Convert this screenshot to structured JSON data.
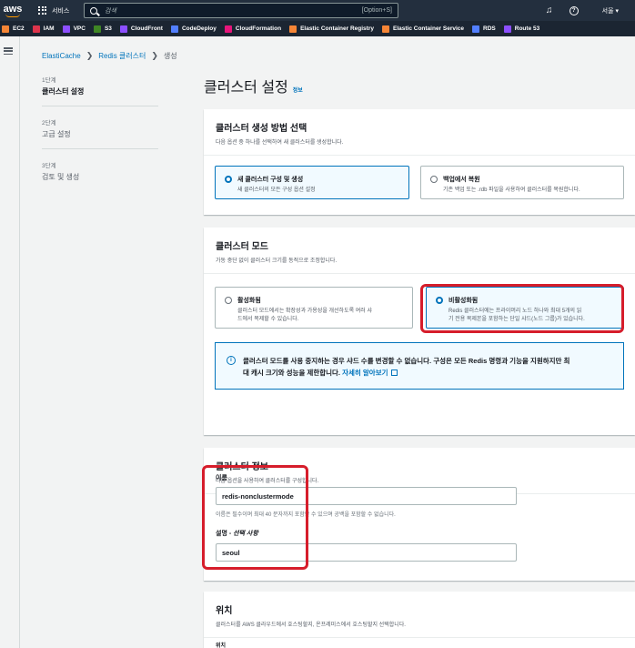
{
  "topnav": {
    "logo": "aws",
    "services_label": "서비스",
    "search_placeholder": "검색",
    "search_shortcut": "[Option+S]",
    "region": "서울 ▾"
  },
  "service_bar": [
    {
      "label": "EC2",
      "color": "#f58536"
    },
    {
      "label": "IAM",
      "color": "#dd344c"
    },
    {
      "label": "VPC",
      "color": "#8c4fff"
    },
    {
      "label": "S3",
      "color": "#3f8624"
    },
    {
      "label": "CloudFront",
      "color": "#8c4fff"
    },
    {
      "label": "CodeDeploy",
      "color": "#527fff"
    },
    {
      "label": "CloudFormation",
      "color": "#e7157b"
    },
    {
      "label": "Elastic Container Registry",
      "color": "#f58536"
    },
    {
      "label": "Elastic Container Service",
      "color": "#f58536"
    },
    {
      "label": "RDS",
      "color": "#527fff"
    },
    {
      "label": "Route 53",
      "color": "#8c4fff"
    }
  ],
  "breadcrumb": {
    "items": [
      "ElastiCache",
      "Redis 클러스터"
    ],
    "current": "생성"
  },
  "steps": [
    {
      "num": "1단계",
      "name": "클러스터 설정"
    },
    {
      "num": "2단계",
      "name": "고급 설정"
    },
    {
      "num": "3단계",
      "name": "검토 및 생성"
    }
  ],
  "page": {
    "title": "클러스터 설정",
    "info": "정보"
  },
  "creation_method": {
    "title": "클러스터 생성 방법 선택",
    "desc": "다음 옵션 중 하나를 선택하여 새 클러스터를 생성합니다.",
    "option_new_title": "새 클러스터 구성 및 생성",
    "option_new_desc": "새 클러스터의 모든 구성 옵션 설정",
    "option_restore_title": "백업에서 복원",
    "option_restore_desc": "기존 백업 또는 .rdb 파일을 사용하여 클러스터를 복원합니다."
  },
  "cluster_mode": {
    "title": "클러스터 모드",
    "desc": "가동 중단 없이 클러스터 크기를 동적으로 조정합니다.",
    "enabled_title": "활성화됨",
    "enabled_desc_1": "클러스터 모드에서는 확장성과 가용성을 개선하도록 여러 샤",
    "enabled_desc_2": "드에서 복제할 수 있습니다.",
    "disabled_title": "비활성화됨",
    "disabled_desc_1": "Redis 클러스터에는 프라이머리 노드 하나와 최대 5개의 읽",
    "disabled_desc_2": "기 전용 복제본을 포함하는 단일 샤드(노드 그룹)가 있습니다.",
    "alert_line1": "클러스터 모드를 사용 중지하는 경우 샤드 수를 변경할 수 없습니다. 구성은 모든 Redis 명령과 기능을 지원하지만 최",
    "alert_line2": "대 캐시 크기와 성능을 제한합니다.",
    "alert_link": "자세히 알아보기"
  },
  "cluster_info": {
    "title": "클러스터 정보",
    "desc": "다음 옵션을 사용하여 클러스터를 구성합니다.",
    "name_label": "이름",
    "name_value": "redis-nonclustermode",
    "name_hint": "이름은 필수이며 최대 40 문자까지 포함할 수 있으며 공백을 포함할 수 없습니다.",
    "desc_label": "설명 - ",
    "desc_optional": "선택 사항",
    "desc_value": "seoul"
  },
  "location": {
    "title": "위치",
    "desc": "클러스터를 AWS 클라우드에서 호스팅할지, 온프레미스에서 호스팅할지 선택합니다.",
    "sub": "위치"
  },
  "colors": {
    "accent": "#0073bb",
    "highlight": "#d61d2b",
    "nav": "#232f3e"
  }
}
